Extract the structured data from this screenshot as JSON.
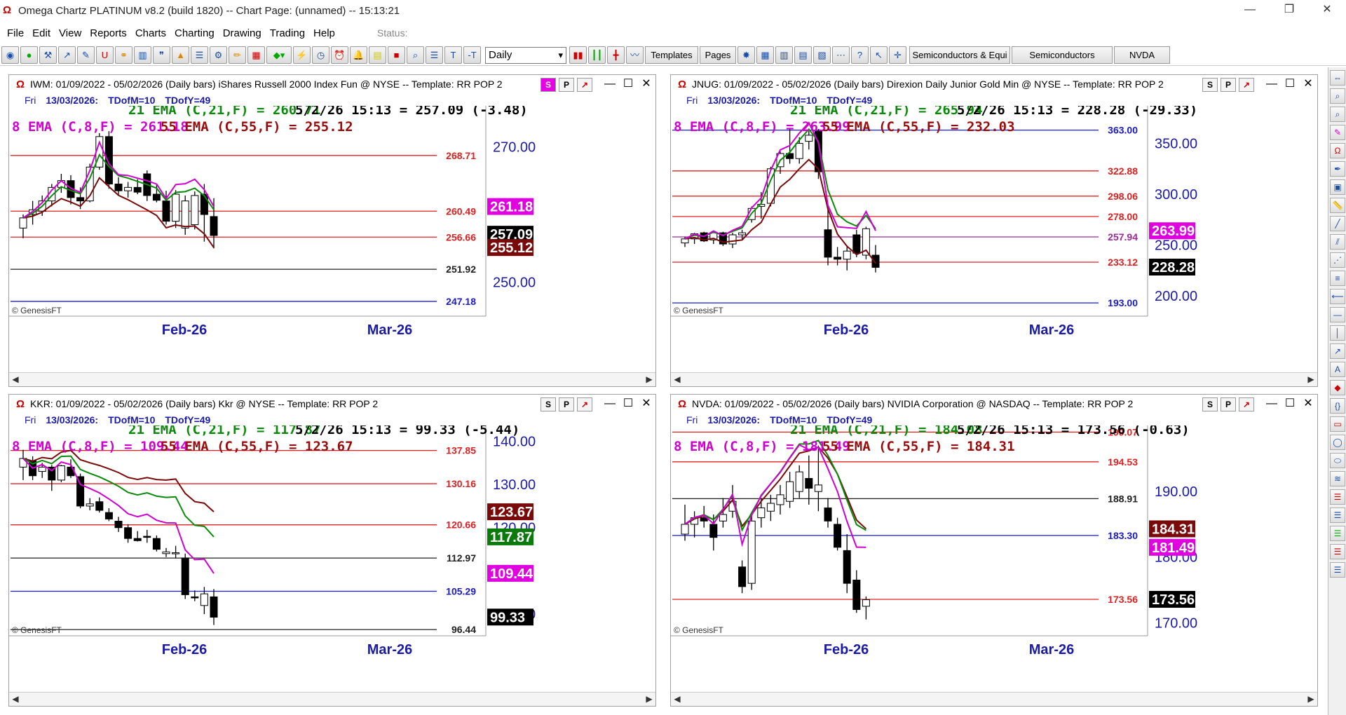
{
  "window": {
    "title": "Omega Chartz PLATINUM v8.2 (build 1820)  --  Chart Page: (unnamed) -- 15:13:21"
  },
  "menu": {
    "items": [
      "File",
      "Edit",
      "View",
      "Reports",
      "Charts",
      "Charting",
      "Drawing",
      "Trading",
      "Help"
    ],
    "status_label": "Status:"
  },
  "toolbar": {
    "period_select": "Daily",
    "templates_label": "Templates",
    "pages_label": "Pages",
    "watchlist_1": "Semiconductors & Equi",
    "watchlist_2": "Semiconductors",
    "watchlist_3": "NVDA"
  },
  "panes": [
    {
      "title": "IWM:  01/09/2022 - 05/02/2026  (Daily bars)   iShares Russell 2000 Index Fun @ NYSE  --  Template: RR POP 2",
      "sub_day": "Fri",
      "sub_date": "13/03/2026:",
      "sub_m": "TDofM=10",
      "sub_y": "TDofY=49",
      "ema21_text": "21 EMA (C,21,F) = 260.71",
      "price_text": "5/2/26 15:13 = 257.09 (-3.48)",
      "ema8_text": "8 EMA (C,8,F) = 261.18",
      "ema55_text": "55 EMA (C,55,F) = 255.12",
      "y_range": [
        245,
        275
      ],
      "y_ticks": [
        "250.00",
        "270.00"
      ],
      "y_tick_values": [
        250,
        270
      ],
      "hlines": [
        {
          "value": 268.71,
          "label": "268.71",
          "color": "#e02020"
        },
        {
          "value": 260.49,
          "label": "260.49",
          "color": "#e02020"
        },
        {
          "value": 256.66,
          "label": "256.66",
          "color": "#e02020"
        },
        {
          "value": 251.92,
          "label": "251.92",
          "color": "#202020"
        },
        {
          "value": 247.18,
          "label": "247.18",
          "color": "#1a1ad0"
        }
      ],
      "tags": [
        {
          "value": 261.18,
          "label": "261.18",
          "bg": "#e000e0",
          "fg": "#ffffff"
        },
        {
          "value": 257.09,
          "label": "257.09",
          "bg": "#000000",
          "fg": "#ffffff"
        },
        {
          "value": 255.12,
          "label": "255.12",
          "bg": "#7a0a0a",
          "fg": "#ffffff"
        }
      ],
      "candles": [
        [
          258,
          260,
          256.5,
          259.5
        ],
        [
          260,
          262,
          258.5,
          260.7
        ],
        [
          260.5,
          262.8,
          259.8,
          262
        ],
        [
          262,
          264.5,
          261.2,
          264
        ],
        [
          264,
          266,
          263.2,
          265
        ],
        [
          265,
          265.8,
          261.5,
          262.5
        ],
        [
          262.5,
          264,
          260.8,
          262
        ],
        [
          262,
          267.5,
          261.8,
          267
        ],
        [
          267,
          272,
          266.6,
          271.5
        ],
        [
          271.5,
          272.3,
          263.8,
          264.5
        ],
        [
          264.5,
          265.5,
          262.8,
          263.5
        ],
        [
          263.5,
          264.8,
          262.5,
          264
        ],
        [
          264,
          265.2,
          263,
          263.3
        ],
        [
          266,
          266.5,
          262,
          262.8
        ],
        [
          263,
          264.5,
          261.8,
          262.1
        ],
        [
          262,
          263.5,
          258.5,
          259
        ],
        [
          259,
          263.6,
          258,
          263
        ],
        [
          258,
          262.8,
          257,
          262
        ],
        [
          258.5,
          263.4,
          257.8,
          262.8
        ],
        [
          263,
          264.5,
          256,
          260
        ],
        [
          259.7,
          262.4,
          255,
          256.9
        ]
      ],
      "dates": [
        "Feb-26",
        "Mar-26"
      ],
      "copyright": "© GenesisFT"
    },
    {
      "title": "JNUG:  01/09/2022 - 05/02/2026  (Daily bars)   Direxion Daily Junior Gold Min @ NYSE  --  Template: RR POP 2",
      "sub_day": "Fri",
      "sub_date": "13/03/2026:",
      "sub_m": "TDofM=10",
      "sub_y": "TDofY=49",
      "ema21_text": "21 EMA (C,21,F) = 265.94",
      "price_text": "5/2/26 15:13 = 228.28 (-29.33)",
      "ema8_text": "8 EMA (C,8,F) = 263.99",
      "ema55_text": "55 EMA (C,55,F) = 232.03",
      "y_range": [
        180,
        380
      ],
      "y_ticks": [
        "200.00",
        "250.00",
        "300.00",
        "350.00"
      ],
      "y_tick_values": [
        200,
        250,
        300,
        350
      ],
      "hlines": [
        {
          "value": 363.0,
          "label": "363.00",
          "color": "#1a1ad0"
        },
        {
          "value": 322.88,
          "label": "322.88",
          "color": "#e02020"
        },
        {
          "value": 298.06,
          "label": "298.06",
          "color": "#e02020"
        },
        {
          "value": 278.0,
          "label": "278.00",
          "color": "#e02020"
        },
        {
          "value": 257.94,
          "label": "257.94",
          "color": "#9a2a9a"
        },
        {
          "value": 233.12,
          "label": "233.12",
          "color": "#e02020"
        },
        {
          "value": 193.0,
          "label": "193.00",
          "color": "#1a1ad0"
        }
      ],
      "tags": [
        {
          "value": 263.99,
          "label": "263.99",
          "bg": "#e000e0",
          "fg": "#ffffff"
        },
        {
          "value": 228.28,
          "label": "228.28",
          "bg": "#000000",
          "fg": "#ffffff"
        }
      ],
      "candles": [
        [
          252,
          258,
          248,
          256
        ],
        [
          256,
          262,
          251,
          261
        ],
        [
          262,
          263,
          253,
          254
        ],
        [
          255,
          264,
          251,
          262
        ],
        [
          262,
          263,
          249,
          251
        ],
        [
          251,
          262,
          247,
          260
        ],
        [
          260,
          265,
          255,
          262
        ],
        [
          275,
          288,
          272,
          286
        ],
        [
          288,
          302,
          276,
          290
        ],
        [
          291,
          327,
          288,
          325
        ],
        [
          327,
          342,
          320,
          340
        ],
        [
          340,
          365,
          330,
          335
        ],
        [
          335,
          356,
          330,
          350
        ],
        [
          352,
          362,
          344,
          358
        ],
        [
          362,
          364,
          315,
          322
        ],
        [
          265,
          285,
          230,
          238
        ],
        [
          238,
          248,
          230,
          236
        ],
        [
          236,
          248,
          225,
          244
        ],
        [
          260,
          265,
          238,
          242
        ],
        [
          240,
          268,
          236,
          266
        ],
        [
          240,
          250,
          223,
          228
        ]
      ],
      "dates": [
        "Feb-26",
        "Mar-26"
      ],
      "copyright": "© GenesisFT"
    },
    {
      "title": "KKR:  01/09/2022 - 05/02/2026  (Daily bars)   Kkr @ NYSE  --  Template: RR POP 2",
      "sub_day": "Fri",
      "sub_date": "13/03/2026:",
      "sub_m": "TDofM=10",
      "sub_y": "TDofY=49",
      "ema21_text": "21 EMA (C,21,F) = 117.87",
      "price_text": "5/2/26 15:13 = 99.33 (-5.44)",
      "ema8_text": "8 EMA (C,8,F) = 109.44",
      "ema55_text": "55 EMA (C,55,F) = 123.67",
      "y_range": [
        95,
        142
      ],
      "y_ticks": [
        "100.00",
        "120.00",
        "130.00",
        "140.00"
      ],
      "y_tick_values": [
        100,
        120,
        130,
        140
      ],
      "hlines": [
        {
          "value": 137.85,
          "label": "137.85",
          "color": "#e02020"
        },
        {
          "value": 130.16,
          "label": "130.16",
          "color": "#e02020"
        },
        {
          "value": 120.66,
          "label": "120.66",
          "color": "#e02020"
        },
        {
          "value": 112.97,
          "label": "112.97",
          "color": "#202020"
        },
        {
          "value": 105.29,
          "label": "105.29",
          "color": "#1a1ad0"
        },
        {
          "value": 96.44,
          "label": "96.44",
          "color": "#202020"
        }
      ],
      "tags": [
        {
          "value": 123.67,
          "label": "123.67",
          "bg": "#7a0a0a",
          "fg": "#ffffff"
        },
        {
          "value": 117.87,
          "label": "117.87",
          "bg": "#0a7a0a",
          "fg": "#ffffff"
        },
        {
          "value": 109.44,
          "label": "109.44",
          "bg": "#e000e0",
          "fg": "#ffffff"
        },
        {
          "value": 99.33,
          "label": "99.33",
          "bg": "#000000",
          "fg": "#ffffff"
        }
      ],
      "candles": [
        [
          134,
          138,
          131,
          136
        ],
        [
          135.5,
          136.5,
          131,
          132
        ],
        [
          133,
          135,
          131.5,
          134
        ],
        [
          134,
          134.5,
          128.5,
          131
        ],
        [
          131,
          134.5,
          130.5,
          134.3
        ],
        [
          134,
          135.8,
          131.5,
          132
        ],
        [
          131.8,
          132.5,
          124.5,
          125
        ],
        [
          125,
          126.8,
          124,
          125.5
        ],
        [
          126,
          127,
          123.5,
          124
        ],
        [
          123.5,
          124.5,
          121.5,
          122
        ],
        [
          121.5,
          122.5,
          119,
          120
        ],
        [
          120,
          120.8,
          116.5,
          117.5
        ],
        [
          117.5,
          119.2,
          116.8,
          117
        ],
        [
          118,
          119.5,
          116.5,
          117.8
        ],
        [
          117.5,
          118.2,
          114.5,
          115
        ],
        [
          114,
          115.3,
          113.2,
          114.4
        ],
        [
          114,
          115.8,
          113,
          114.2
        ],
        [
          113,
          114,
          103.5,
          104.5
        ],
        [
          104,
          105.5,
          103,
          103.8
        ],
        [
          102,
          106.3,
          100,
          104.7
        ],
        [
          104,
          105.8,
          97.5,
          99.3
        ]
      ],
      "dates": [
        "Feb-26",
        "Mar-26"
      ],
      "copyright": "© GenesisFT"
    },
    {
      "title": "NVDA:  01/09/2022 - 05/02/2026  (Daily bars)   NVIDIA Corporation @ NASDAQ  --  Template: RR POP 2",
      "sub_day": "Fri",
      "sub_date": "13/03/2026:",
      "sub_m": "TDofM=10",
      "sub_y": "TDofY=49",
      "ema21_text": "21 EMA (C,21,F) = 184.08",
      "price_text": "5/2/26 15:13 = 173.56 (-0.63)",
      "ema8_text": "8 EMA (C,8,F) = 181.49",
      "ema55_text": "55 EMA (C,55,F) = 184.31",
      "y_range": [
        168,
        199
      ],
      "y_ticks": [
        "170.00",
        "180.00",
        "190.00"
      ],
      "y_tick_values": [
        170,
        180,
        190
      ],
      "hlines": [
        {
          "value": 199.07,
          "label": "199.07",
          "color": "#e02020"
        },
        {
          "value": 194.53,
          "label": "194.53",
          "color": "#e02020"
        },
        {
          "value": 188.91,
          "label": "188.91",
          "color": "#202020"
        },
        {
          "value": 183.3,
          "label": "183.30",
          "color": "#1a1ad0"
        },
        {
          "value": 173.56,
          "label": "173.56",
          "color": "#e02020"
        }
      ],
      "tags": [
        {
          "value": 184.31,
          "label": "184.31",
          "bg": "#7a0a0a",
          "fg": "#ffffff"
        },
        {
          "value": 181.49,
          "label": "181.49",
          "bg": "#e000e0",
          "fg": "#ffffff"
        },
        {
          "value": 173.56,
          "label": "173.56",
          "bg": "#000000",
          "fg": "#ffffff"
        }
      ],
      "candles": [
        [
          183.5,
          188,
          182.5,
          185
        ],
        [
          185,
          187,
          183,
          186
        ],
        [
          186,
          187.8,
          184.5,
          185.5
        ],
        [
          185,
          186.5,
          181,
          183
        ],
        [
          185.5,
          189,
          184.5,
          186.5
        ],
        [
          187,
          191,
          186,
          188.5
        ],
        [
          178.5,
          179.5,
          174.5,
          175.5
        ],
        [
          176,
          186.5,
          175,
          185.5
        ],
        [
          186,
          189,
          184.5,
          187.5
        ],
        [
          187,
          189.5,
          185.5,
          188.2
        ],
        [
          188,
          191,
          186.5,
          189.5
        ],
        [
          188.5,
          193,
          187.5,
          191.5
        ],
        [
          190,
          194,
          189,
          193
        ],
        [
          192,
          195.5,
          188,
          190.5
        ],
        [
          190,
          197,
          187,
          191
        ],
        [
          187.5,
          189,
          184.5,
          185.5
        ],
        [
          185,
          186,
          181,
          181.5
        ],
        [
          181,
          183.5,
          174.5,
          176
        ],
        [
          176.5,
          178,
          171.5,
          172
        ],
        [
          172.5,
          174,
          170.5,
          173.5
        ]
      ],
      "dates": [
        "Feb-26",
        "Mar-26"
      ],
      "copyright": "© GenesisFT"
    }
  ]
}
